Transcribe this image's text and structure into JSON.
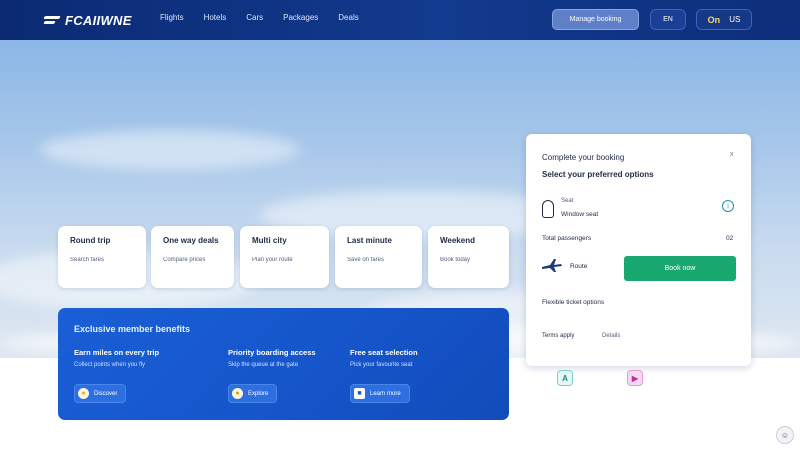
{
  "brand": {
    "logo_text": "FCAIIWNE"
  },
  "nav": {
    "items": [
      {
        "label": "Flights"
      },
      {
        "label": "Hotels"
      },
      {
        "label": "Cars"
      },
      {
        "label": "Packages"
      },
      {
        "label": "Deals"
      }
    ]
  },
  "header": {
    "cta_label": "Manage booking",
    "lang_label": "EN",
    "user_label": "On",
    "user_suffix": "US"
  },
  "cards": [
    {
      "title": "Round trip",
      "sub": "Search fares"
    },
    {
      "title": "One way deals",
      "sub": "Compare prices"
    },
    {
      "title": "Multi city",
      "sub": "Plan your route"
    },
    {
      "title": "Last minute",
      "sub": "Save on fares"
    },
    {
      "title": "Weekend",
      "sub": "Book today"
    }
  ],
  "promo": {
    "title": "Exclusive member benefits",
    "columns": [
      {
        "title": "Earn miles on every trip",
        "sub": "Collect points when you fly",
        "button": "Discover",
        "icon_color": "#f5a623",
        "icon_char": "●"
      },
      {
        "title": "Priority boarding access",
        "sub": "Skip the queue at the gate",
        "button": "Explore",
        "icon_color": "#f2c230",
        "icon_char": "●"
      },
      {
        "title": "Free seat selection",
        "sub": "Pick your favourite seat",
        "button": "Learn more",
        "icon_color": "#ffffff",
        "icon_char": "■"
      }
    ]
  },
  "booking": {
    "heading": "Complete your booking",
    "close_label": "x",
    "sub": "Select your preferred options",
    "seat_line1": "Seat",
    "seat_line2": "Window seat",
    "row_label": "Total passengers",
    "row_value": "02",
    "route_text": "Route",
    "book_button": "Book now",
    "line1": "Flexible ticket options",
    "line2": "Terms apply",
    "line2_end": "Details"
  },
  "colors": {
    "header": "#0b2a73",
    "promo": "#1a5fd6",
    "book_button": "#19a86f"
  }
}
